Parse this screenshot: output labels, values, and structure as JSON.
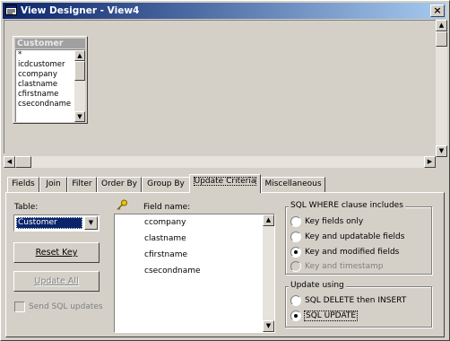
{
  "window": {
    "title": "View Designer - View4",
    "close_label": "×"
  },
  "table_box": {
    "title": "Customer",
    "fields": [
      "*",
      "icdcustomer",
      "ccompany",
      "clastname",
      "cfirstname",
      "csecondname"
    ]
  },
  "tabs": [
    {
      "label": "Fields",
      "active": false
    },
    {
      "label": "Join",
      "active": false
    },
    {
      "label": "Filter",
      "active": false
    },
    {
      "label": "Order By",
      "active": false
    },
    {
      "label": "Group By",
      "active": false
    },
    {
      "label": "Update Criteria",
      "active": true
    },
    {
      "label": "Miscellaneous",
      "active": false
    }
  ],
  "update_criteria": {
    "table_label": "Table:",
    "table_value": "Customer",
    "reset_key_label": "Reset Key",
    "update_all_label": "Update All",
    "send_sql_label": "Send SQL updates",
    "field_name_header": "Field name:",
    "fields": [
      "ccompany",
      "clastname",
      "cfirstname",
      "csecondname"
    ],
    "where_group": {
      "title": "SQL WHERE clause includes",
      "options": [
        {
          "label": "Key fields only",
          "checked": false,
          "disabled": false
        },
        {
          "label": "Key and updatable fields",
          "checked": false,
          "disabled": false
        },
        {
          "label": "Key and modified fields",
          "checked": true,
          "disabled": false
        },
        {
          "label": "Key and timestamp",
          "checked": false,
          "disabled": true
        }
      ]
    },
    "update_group": {
      "title": "Update using",
      "options": [
        {
          "label": "SQL DELETE then INSERT",
          "checked": false
        },
        {
          "label": "SQL UPDATE",
          "checked": true
        }
      ]
    }
  },
  "colors": {
    "titlebar_start": "#0a246a",
    "titlebar_end": "#a6caf0",
    "face": "#d4d0c8",
    "selection": "#0a246a"
  }
}
